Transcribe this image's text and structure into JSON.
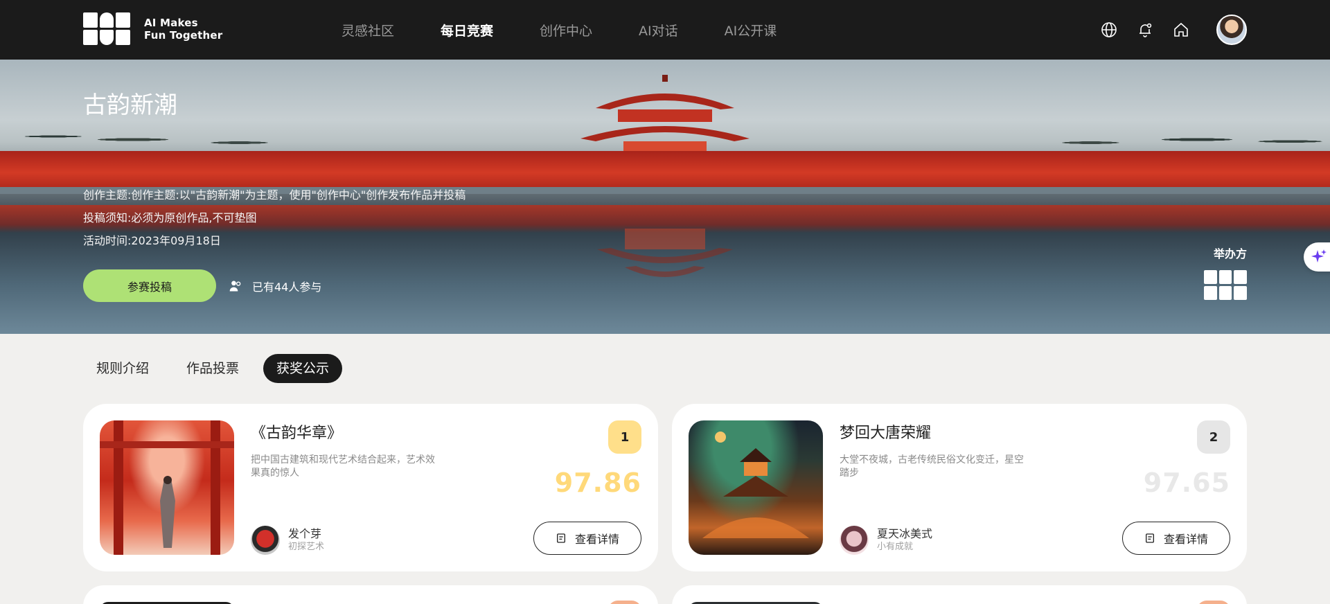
{
  "brand": {
    "line1": "AI Makes",
    "line2": "Fun Together"
  },
  "nav": {
    "items": [
      {
        "label": "灵感社区"
      },
      {
        "label": "每日竞赛"
      },
      {
        "label": "创作中心"
      },
      {
        "label": "AI对话"
      },
      {
        "label": "AI公开课"
      }
    ],
    "active_index": 1,
    "icons": [
      "globe-icon",
      "bell-icon",
      "home-icon",
      "user-avatar"
    ]
  },
  "hero": {
    "title": "古韵新潮",
    "theme_line": "创作主题:创作主题:以\"古韵新潮\"为主题，使用\"创作中心\"创作发布作品并投稿",
    "rules_line": "投稿须知:必须为原创作品,不可垫图",
    "time_line": "活动时间:2023年09月18日",
    "join_button": "参赛投稿",
    "participants": "已有44人参与",
    "organizer_label": "举办方"
  },
  "tabs": [
    {
      "label": "规则介绍"
    },
    {
      "label": "作品投票"
    },
    {
      "label": "获奖公示"
    }
  ],
  "active_tab": 2,
  "results": [
    {
      "title": "《古韵华章》",
      "description": "把中国古建筑和现代艺术结合起来，艺术效果真的惊人",
      "rank": "1",
      "score": "97.86",
      "author": "发个芽",
      "level": "初探艺术",
      "detail_button": "查看详情",
      "rank_color": "#ffdf8a",
      "score_color": "#ffd97a"
    },
    {
      "title": "梦回大唐荣耀",
      "description": "大堂不夜城，古老传统民俗文化变迁，星空踏步",
      "rank": "2",
      "score": "97.65",
      "author": "夏天冰美式",
      "level": "小有成就",
      "detail_button": "查看详情",
      "rank_color": "#e6e6e6",
      "score_color": "#e8e8e8"
    }
  ],
  "colors": {
    "accent_green": "#aee175",
    "dark": "#1b1b1b"
  }
}
